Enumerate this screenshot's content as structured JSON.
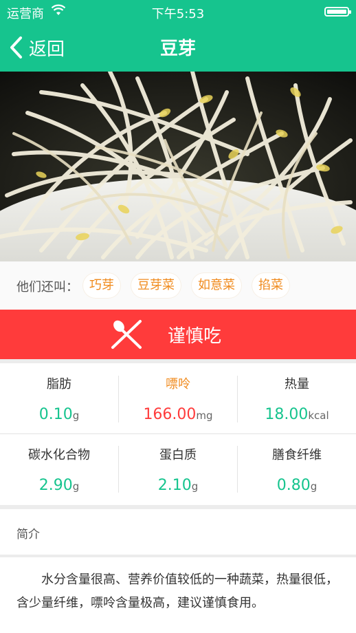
{
  "status_bar": {
    "carrier": "运营商",
    "time": "下午5:53"
  },
  "nav": {
    "back_label": "返回",
    "title": "豆芽"
  },
  "alias": {
    "label": "他们还叫：",
    "names": [
      "巧芽",
      "豆芽菜",
      "如意菜",
      "掐菜"
    ]
  },
  "warning": {
    "label": "谨慎吃",
    "color": "#ff3b3b"
  },
  "nutrition": [
    {
      "name": "脂肪",
      "value": "0.10",
      "unit": "g",
      "name_color": "#333333",
      "value_color": "#16c48e"
    },
    {
      "name": "嘌呤",
      "value": "166.00",
      "unit": "mg",
      "name_color": "#f08a1c",
      "value_color": "#ff3b3b"
    },
    {
      "name": "热量",
      "value": "18.00",
      "unit": "kcal",
      "name_color": "#333333",
      "value_color": "#16c48e"
    },
    {
      "name": "碳水化合物",
      "value": "2.90",
      "unit": "g",
      "name_color": "#333333",
      "value_color": "#16c48e"
    },
    {
      "name": "蛋白质",
      "value": "2.10",
      "unit": "g",
      "name_color": "#333333",
      "value_color": "#16c48e"
    },
    {
      "name": "膳食纤维",
      "value": "0.80",
      "unit": "g",
      "name_color": "#333333",
      "value_color": "#16c48e"
    }
  ],
  "intro": {
    "heading": "简介",
    "text": "水分含量很高、营养价值较低的一种蔬菜，热量很低，含少量纤维，嘌呤含量极高，建议谨慎食用。"
  },
  "colors": {
    "brand": "#16c48e",
    "warning": "#ff3b3b",
    "alias_tag": "#f08a1c"
  }
}
